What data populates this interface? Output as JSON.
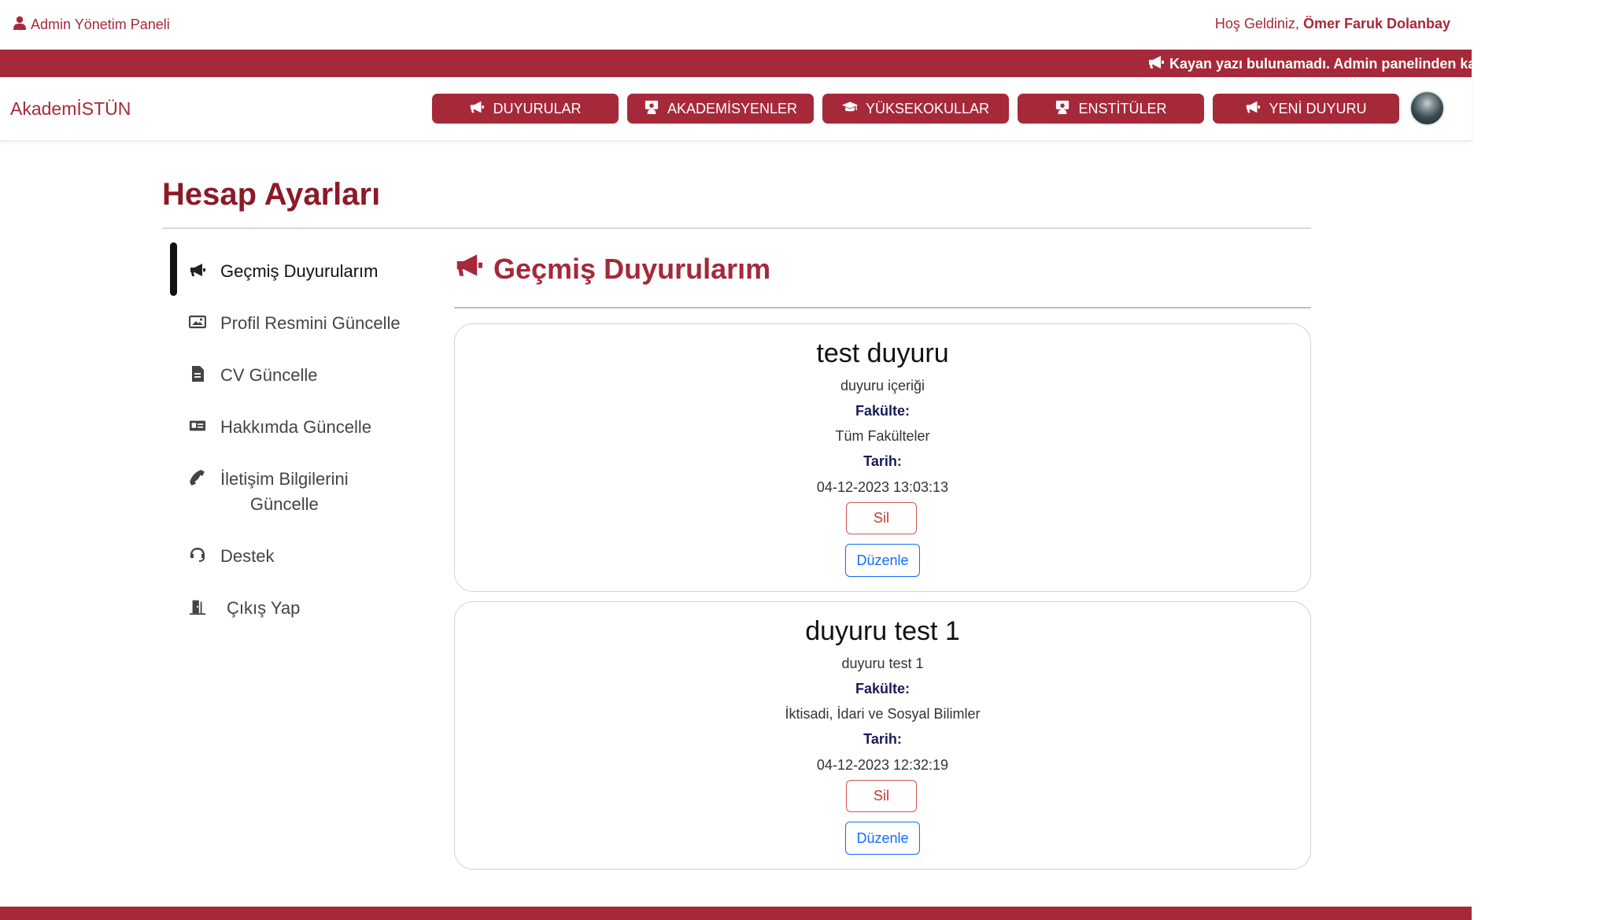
{
  "topbar": {
    "admin_label": "Admin Yönetim Paneli",
    "welcome_prefix": "Hoş Geldiniz, ",
    "user_name": "Ömer Faruk Dolanbay"
  },
  "ticker": {
    "text": "Kayan yazı bulunamadı. Admin panelinden ka"
  },
  "navbar": {
    "brand": "AkademİSTÜN",
    "buttons": [
      {
        "label": "DUYURULAR",
        "icon": "megaphone-icon"
      },
      {
        "label": "AKADEMİSYENLER",
        "icon": "teacher-icon"
      },
      {
        "label": "YÜKSEKOKULLAR",
        "icon": "graduation-cap-icon"
      },
      {
        "label": "ENSTİTÜLER",
        "icon": "teacher-icon"
      },
      {
        "label": "YENİ DUYURU",
        "icon": "megaphone-icon"
      }
    ]
  },
  "page": {
    "title": "Hesap Ayarları"
  },
  "sidebar": {
    "items": [
      {
        "label": "Geçmiş Duyurularım",
        "icon": "megaphone-icon",
        "active": true
      },
      {
        "label": "Profil Resmini Güncelle",
        "icon": "image-icon"
      },
      {
        "label": "CV Güncelle",
        "icon": "file-icon"
      },
      {
        "label": "Hakkımda Güncelle",
        "icon": "id-card-icon"
      },
      {
        "label": "İletişim Bilgilerini",
        "label2": "Güncelle",
        "icon": "phone-icon"
      },
      {
        "label": "Destek",
        "icon": "headset-icon"
      },
      {
        "label": "Çıkış Yap",
        "icon": "door-icon"
      }
    ]
  },
  "section": {
    "title": "Geçmiş Duyurularım"
  },
  "announcements": [
    {
      "title": "test duyuru",
      "content": "duyuru içeriği",
      "faculty_label": "Fakülte:",
      "faculty": "Tüm Fakülteler",
      "date_label": "Tarih:",
      "date": "04-12-2023 13:03:13",
      "delete_label": "Sil",
      "edit_label": "Düzenle"
    },
    {
      "title": "duyuru test 1",
      "content": "duyuru test 1",
      "faculty_label": "Fakülte:",
      "faculty": "İktisadi, İdari ve Sosyal Bilimler",
      "date_label": "Tarih:",
      "date": "04-12-2023 12:32:19",
      "delete_label": "Sil",
      "edit_label": "Düzenle"
    }
  ],
  "colors": {
    "brand": "#a6293a",
    "title": "#8b1a27",
    "delete": "#d9534f",
    "edit": "#0d6efd"
  }
}
